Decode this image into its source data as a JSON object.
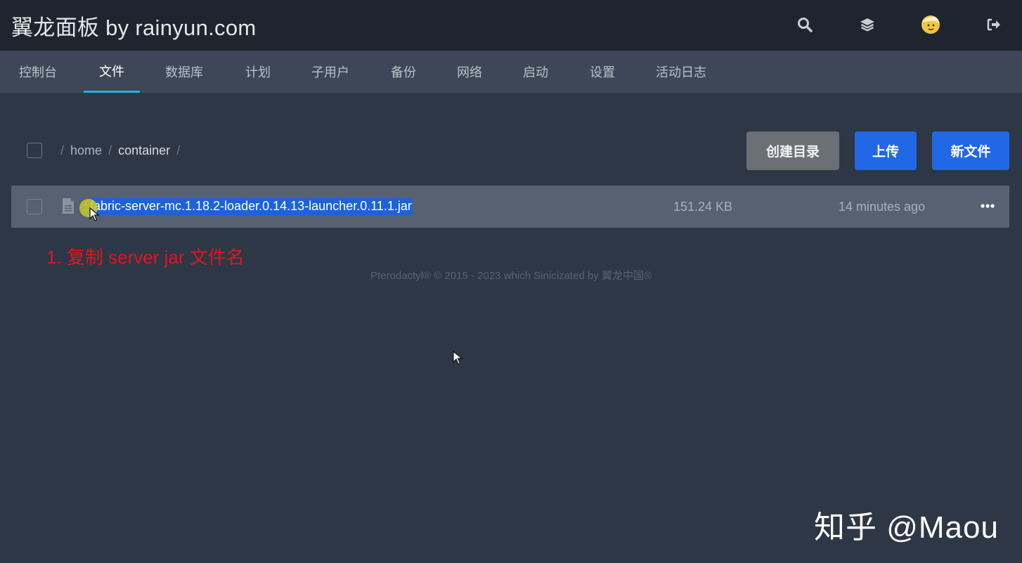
{
  "header": {
    "brand": "翼龙面板 by rainyun.com",
    "icons": [
      "search-icon",
      "layers-icon",
      "avatar",
      "logout-icon"
    ]
  },
  "tabs": [
    "控制台",
    "文件",
    "数据库",
    "计划",
    "子用户",
    "备份",
    "网络",
    "启动",
    "设置",
    "活动日志"
  ],
  "active_tab": "文件",
  "breadcrumb": {
    "sep": "/",
    "home": "home",
    "container": "container"
  },
  "actions": {
    "create_dir": "创建目录",
    "upload": "上传",
    "new_file": "新文件"
  },
  "files": [
    {
      "name": "fabric-server-mc.1.18.2-loader.0.14.13-launcher.0.11.1.jar",
      "size": "151.24 KB",
      "modified": "14 minutes ago"
    }
  ],
  "annotation": "1. 复制 server jar 文件名",
  "footer": "Pterodactyl® © 2015 - 2023 which Sinicizated by 翼龙中国®",
  "watermark": "知乎 @Maou",
  "colors": {
    "topbar": "#1e252e",
    "tabbar": "#3d4757",
    "page": "#2e3745",
    "accent": "#25b0e0",
    "primary_button": "#2168e6",
    "selection": "#1c63d8",
    "annotation": "#e0161b"
  }
}
